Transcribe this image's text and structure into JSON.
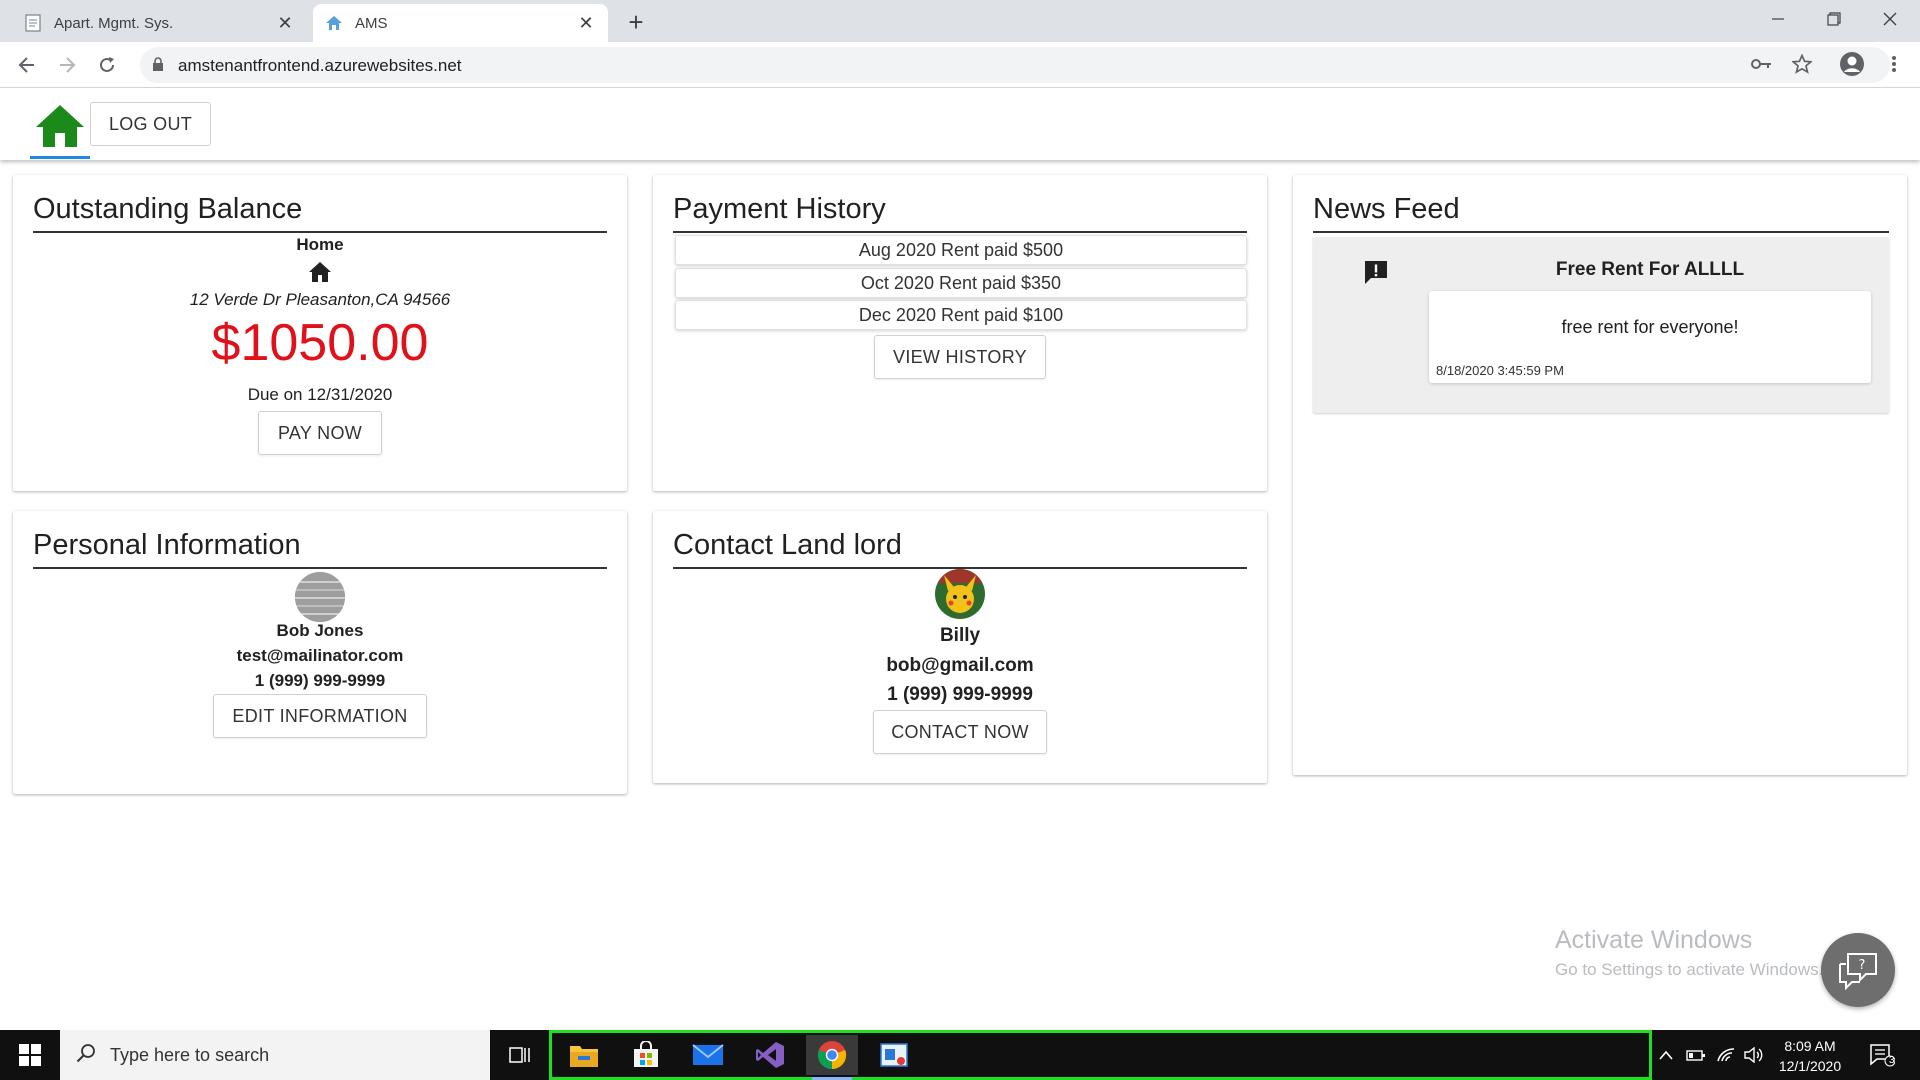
{
  "browser": {
    "tabs": [
      {
        "title": "Apart. Mgmt. Sys.",
        "active": false
      },
      {
        "title": "AMS",
        "active": true
      }
    ],
    "url": "amstenantfrontend.azurewebsites.net"
  },
  "appbar": {
    "logout_label": "LOG OUT",
    "home_color": "#1b8a1b"
  },
  "balance": {
    "title": "Outstanding Balance",
    "property_label": "Home",
    "address": "12 Verde Dr Pleasanton,CA 94566",
    "amount": "$1050.00",
    "amount_color": "#e0111b",
    "due": "Due on 12/31/2020",
    "pay_label": "PAY NOW"
  },
  "payments": {
    "title": "Payment History",
    "items": [
      "Aug 2020 Rent paid $500",
      "Oct 2020 Rent paid $350",
      "Dec 2020 Rent paid $100"
    ],
    "view_label": "VIEW HISTORY"
  },
  "news": {
    "title": "News Feed",
    "items": [
      {
        "title": "Free Rent For ALLLL",
        "body": "free rent for everyone!",
        "timestamp": "8/18/2020 3:45:59 PM",
        "icon": "feedback-icon"
      }
    ]
  },
  "personal": {
    "title": "Personal Information",
    "name": "Bob Jones",
    "email": "test@mailinator.com",
    "phone": "1 (999) 999-9999",
    "edit_label": "EDIT INFORMATION"
  },
  "landlord": {
    "title": "Contact Land lord",
    "name": "Billy",
    "email": "bob@gmail.com",
    "phone": "1 (999) 999-9999",
    "contact_label": "CONTACT NOW"
  },
  "watermark": {
    "title": "Activate Windows",
    "subtitle": "Go to Settings to activate Windows."
  },
  "taskbar": {
    "search_placeholder": "Type here to search",
    "apps": [
      "file-explorer-icon",
      "store-icon",
      "mail-icon",
      "visual-studio-icon",
      "chrome-icon",
      "snip-icon"
    ],
    "time": "8:09 AM",
    "date": "12/1/2020",
    "notification_count": "3",
    "highlight_color": "#1fe01f"
  }
}
